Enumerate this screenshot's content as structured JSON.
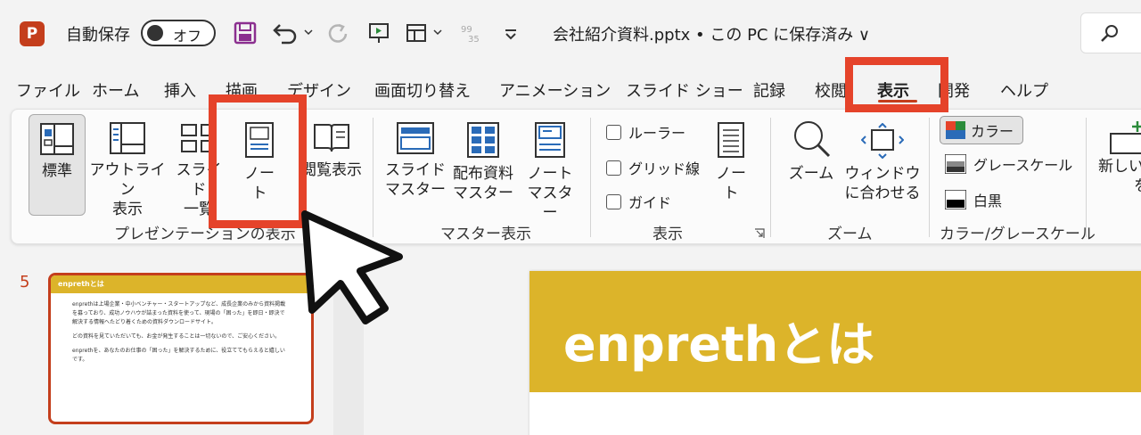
{
  "titlebar": {
    "app_logo": "P",
    "autosave_label": "自動保存",
    "autosave_state": "オフ",
    "qa_icons": [
      "save-icon",
      "undo-icon",
      "redo-icon",
      "present-from-start-icon",
      "table-insert-icon",
      "number-icon",
      "customize-icon"
    ],
    "doc_title": "会社紹介資料.pptx • この PC に保存済み ∨"
  },
  "tabs": [
    {
      "label": "ファイル"
    },
    {
      "label": "ホーム"
    },
    {
      "label": "挿入"
    },
    {
      "label": "描画"
    },
    {
      "label": "デザイン"
    },
    {
      "label": "画面切り替え"
    },
    {
      "label": "アニメーション"
    },
    {
      "label": "スライド ショー"
    },
    {
      "label": "記録"
    },
    {
      "label": "校閲"
    },
    {
      "label": "表示"
    },
    {
      "label": "開発"
    },
    {
      "label": "ヘルプ"
    }
  ],
  "active_tab": "表示",
  "ribbon": {
    "presentation_views": {
      "label": "プレゼンテーションの表示",
      "buttons": [
        {
          "label": "標準"
        },
        {
          "label": "アウトライン\n表示"
        },
        {
          "label": "スライド\n一覧"
        },
        {
          "label": "ノー\nト"
        },
        {
          "label": "閲覧表示"
        }
      ]
    },
    "master_views": {
      "label": "マスター表示",
      "buttons": [
        {
          "label": "スライド\nマスター"
        },
        {
          "label": "配布資料\nマスター"
        },
        {
          "label": "ノート\nマスター"
        }
      ]
    },
    "show": {
      "label": "表示",
      "checkboxes": [
        {
          "label": "ルーラー",
          "checked": false
        },
        {
          "label": "グリッド線",
          "checked": false
        },
        {
          "label": "ガイド",
          "checked": false
        }
      ],
      "notes_button": "ノー\nト"
    },
    "zoom": {
      "label": "ズーム",
      "buttons": [
        {
          "label": "ズーム"
        },
        {
          "label": "ウィンドウ\nに合わせる"
        }
      ]
    },
    "color": {
      "label": "カラー/グレースケール",
      "options": [
        {
          "label": "カラー",
          "selected": true
        },
        {
          "label": "グレースケール"
        },
        {
          "label": "白黒"
        }
      ]
    },
    "new_window": {
      "label_line1": "新しい",
      "label_line2": "を"
    }
  },
  "slides_pane": {
    "slide_number": "5",
    "thumb_title": "enprethとは",
    "thumb_paragraphs": [
      "enprethは上場企業・中小ベンチャー・スタートアップなど、成長企業のみから資料掲載を募っており、成功ノウハウが詰まった資料を使って、現場の「困った」を即日・即決で解決する情報へたどり着くための資料ダウンロードサイト。",
      "どの資料を見ていただいても、お金が発生することは一切ないので、ご安心ください。",
      "enprethを、あなたのお仕事の「困った」を解決するために、役立ててもらえると嬉しいです。"
    ]
  },
  "slide": {
    "title": "enprethとは"
  }
}
